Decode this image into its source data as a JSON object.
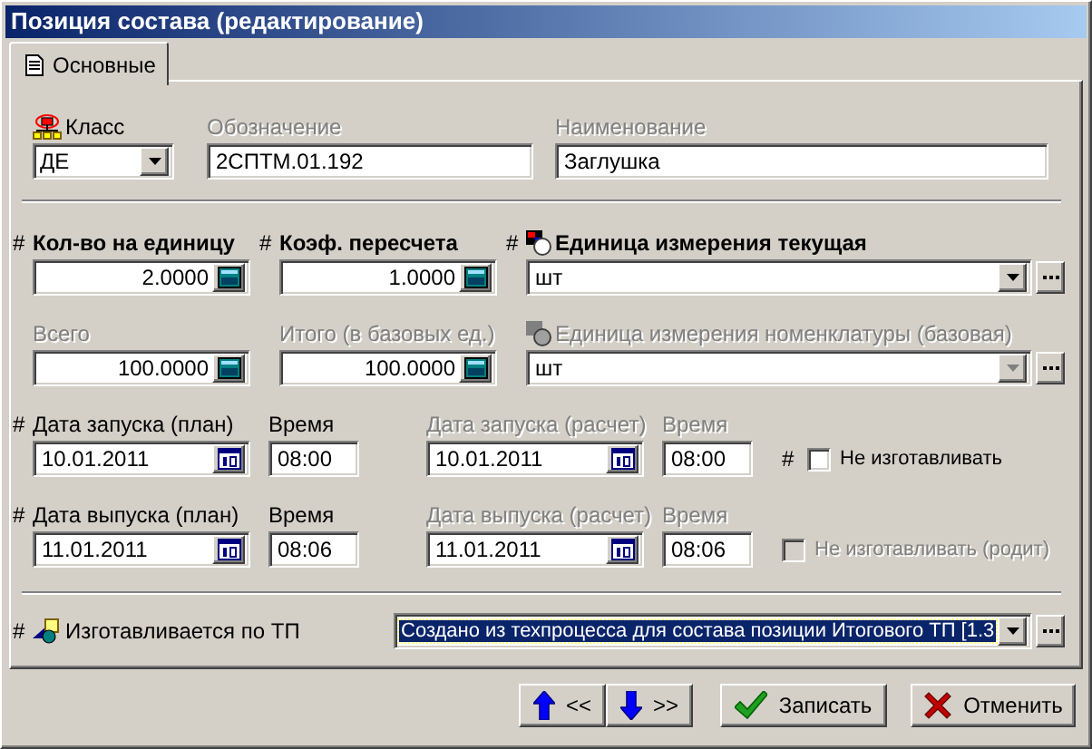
{
  "window": {
    "title": "Позиция состава (редактирование)"
  },
  "tabs": [
    {
      "label": "Основные",
      "selected": true
    }
  ],
  "header_fields": [
    {
      "kind": "combo",
      "label": "Класс",
      "value": "ДЕ",
      "dimmed": false
    },
    {
      "kind": "text",
      "label": "Обозначение",
      "value": "2СПТМ.01.192",
      "dimmed": true
    },
    {
      "kind": "text",
      "label": "Наименование",
      "value": "Заглушка",
      "dimmed": true
    }
  ],
  "quantity_rows": [
    {
      "fields": [
        {
          "marker": "#",
          "label": "Кол-во на единицу",
          "value": "2.0000",
          "bold": true,
          "dimmed": false
        },
        {
          "marker": "#",
          "label": "Коэф. пересчета",
          "value": "1.0000",
          "bold": true,
          "dimmed": false
        }
      ],
      "unit": {
        "marker": "#",
        "label": "Единица измерения текущая",
        "value": "шт",
        "bold": true,
        "dimmed": false
      }
    },
    {
      "fields": [
        {
          "label": "Всего",
          "value": "100.0000",
          "bold": false,
          "dimmed": true
        },
        {
          "label": "Итого (в базовых ед.)",
          "value": "100.0000",
          "bold": false,
          "dimmed": true
        }
      ],
      "unit": {
        "label": "Единица измерения номенклатуры (базовая)",
        "value": "шт",
        "bold": false,
        "dimmed": true
      }
    }
  ],
  "date_rows": [
    {
      "plan": {
        "marker": "#",
        "label": "Дата запуска (план)",
        "value": "10.01.2011"
      },
      "plan_time": {
        "label": "Время",
        "value": "08:00"
      },
      "calc": {
        "label": "Дата запуска (расчет)",
        "value": "10.01.2011"
      },
      "calc_time": {
        "label": "Время",
        "value": "08:00"
      },
      "option": {
        "marker": "#",
        "label": "Не изготавливать",
        "checked": false,
        "disabled": false
      }
    },
    {
      "plan": {
        "marker": "#",
        "label": "Дата выпуска (план)",
        "value": "11.01.2011"
      },
      "plan_time": {
        "label": "Время",
        "value": "08:06"
      },
      "calc": {
        "label": "Дата выпуска (расчет)",
        "value": "11.01.2011"
      },
      "calc_time": {
        "label": "Время",
        "value": "08:06"
      },
      "option": {
        "label": "Не изготавливать (родит)",
        "checked": false,
        "disabled": true
      }
    }
  ],
  "process": {
    "marker": "#",
    "label": "Изготавливается по ТП",
    "value": "Создано из техпроцесса для состава позиции Итогового ТП [1.3",
    "selected": true
  },
  "buttons": [
    {
      "kind": "prev",
      "label": "<<"
    },
    {
      "kind": "next",
      "label": ">>"
    },
    {
      "kind": "save",
      "label": "Записать"
    },
    {
      "kind": "cancel",
      "label": "Отменить"
    }
  ]
}
